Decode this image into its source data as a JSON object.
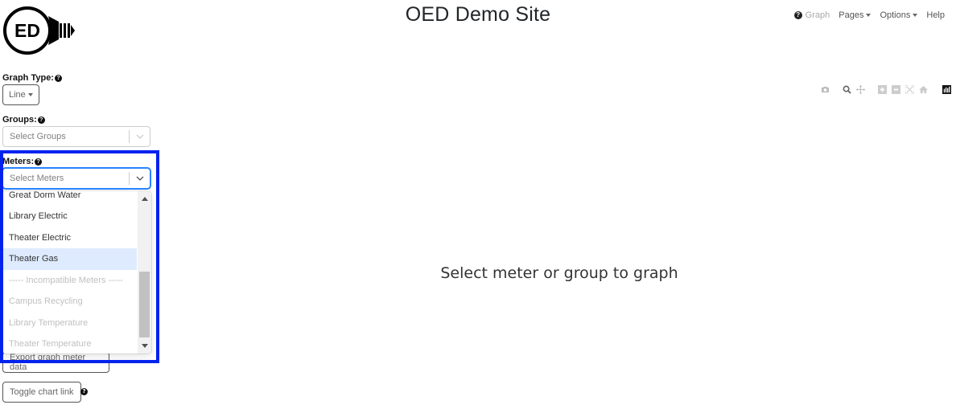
{
  "header": {
    "logo_text": "ED",
    "title": "OED Demo Site",
    "nav": {
      "graph": "Graph",
      "pages": "Pages",
      "options": "Options",
      "help": "Help"
    }
  },
  "toolbar": {
    "icons": [
      "camera-icon",
      "zoom-icon",
      "pan-icon",
      "zoom-in-icon",
      "zoom-out-icon",
      "autoscale-icon",
      "reset-axes-icon",
      "plotly-logo-icon"
    ]
  },
  "sidebar": {
    "graph_type": {
      "label": "Graph Type:",
      "value": "Line"
    },
    "groups": {
      "label": "Groups:",
      "placeholder": "Select Groups"
    },
    "meters": {
      "label": "Meters:",
      "placeholder": "Select Meters",
      "options": [
        {
          "label": "Great Dorm Water",
          "state": "normal"
        },
        {
          "label": "Library Electric",
          "state": "normal"
        },
        {
          "label": "Theater Electric",
          "state": "normal"
        },
        {
          "label": "Theater Gas",
          "state": "focused"
        },
        {
          "label": "----- Incompatible Meters -----",
          "state": "disabled"
        },
        {
          "label": "Campus Recycling",
          "state": "disabled"
        },
        {
          "label": "Library Temperature",
          "state": "disabled"
        },
        {
          "label": "Theater Temperature",
          "state": "disabled"
        }
      ]
    },
    "export_button": "Export graph meter data",
    "toggle_chart_link": "Toggle chart link"
  },
  "main": {
    "empty_message": "Select meter or group to graph"
  },
  "colors": {
    "highlight_border": "#0022ee",
    "focus_ring": "#2684ff",
    "option_focused": "#deebff"
  }
}
